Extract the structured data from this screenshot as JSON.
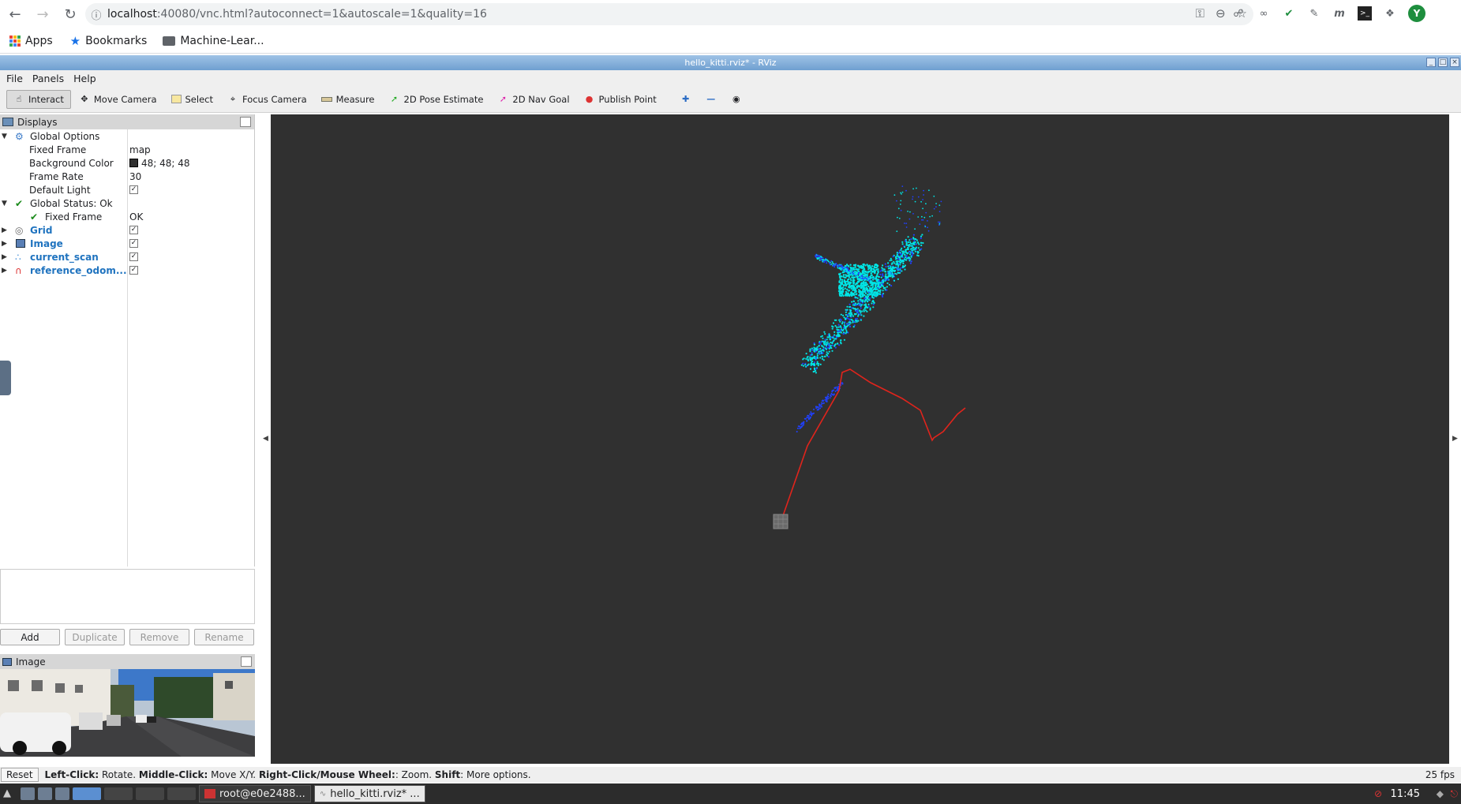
{
  "browser": {
    "url_host": "localhost",
    "url_rest": ":40080/vnc.html?autoconnect=1&autoscale=1&quality=16",
    "profile_initial": "Y",
    "bookmarks": [
      "Apps",
      "Bookmarks",
      "Machine-Lear..."
    ]
  },
  "rviz": {
    "window_title": "hello_kitti.rviz* - RViz",
    "menu": [
      "File",
      "Panels",
      "Help"
    ],
    "tools": [
      "Interact",
      "Move Camera",
      "Select",
      "Focus Camera",
      "Measure",
      "2D Pose Estimate",
      "2D Nav Goal",
      "Publish Point"
    ],
    "displays": {
      "title": "Displays",
      "global_options": "Global Options",
      "fixed_frame_label": "Fixed Frame",
      "fixed_frame_value": "map",
      "bg_color_label": "Background Color",
      "bg_color_value": "48; 48; 48",
      "frame_rate_label": "Frame Rate",
      "frame_rate_value": "30",
      "default_light_label": "Default Light",
      "global_status": "Global Status: Ok",
      "status_fixed_frame": "Fixed Frame",
      "status_fixed_frame_value": "OK",
      "items": [
        "Grid",
        "Image",
        "current_scan",
        "reference_odom..."
      ]
    },
    "buttons": [
      "Add",
      "Duplicate",
      "Remove",
      "Rename"
    ],
    "image_panel_title": "Image",
    "status": {
      "reset": "Reset",
      "left_click": "Left-Click:",
      "left_click_desc": " Rotate. ",
      "middle_click": "Middle-Click:",
      "middle_click_desc": " Move X/Y. ",
      "right_click": "Right-Click/Mouse Wheel:",
      "right_click_desc": ": Zoom. ",
      "shift": "Shift",
      "shift_desc": ": More options.",
      "fps": "25 fps"
    },
    "colors": {
      "background": "#303030",
      "trajectory": "#e0241c",
      "scan_cyan": "#00e5e5",
      "scan_blue": "#2040ff"
    }
  },
  "taskbar": {
    "tasks": [
      "root@e0e2488...",
      "hello_kitti.rviz* ..."
    ],
    "clock": "11:45"
  }
}
